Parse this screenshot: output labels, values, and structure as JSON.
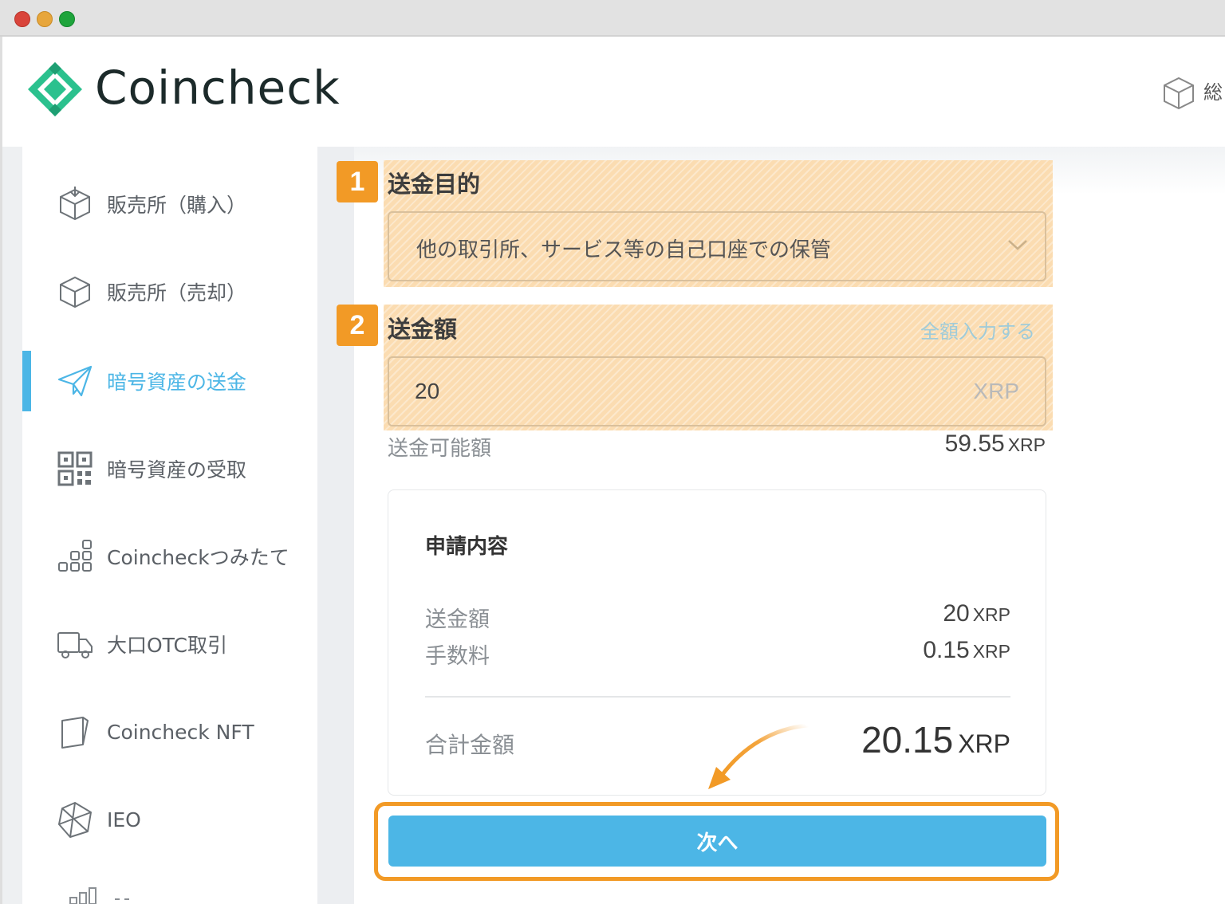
{
  "app": {
    "brand": "Coincheck",
    "header_right_label": "総"
  },
  "sidebar": {
    "items": [
      {
        "label": "販売所（購入）",
        "icon": "box-icon"
      },
      {
        "label": "販売所（売却）",
        "icon": "box-icon"
      },
      {
        "label": "暗号資産の送金",
        "icon": "paper-plane-icon",
        "active": true
      },
      {
        "label": "暗号資産の受取",
        "icon": "qr-code-icon"
      },
      {
        "label": "Coincheckつみたて",
        "icon": "stacked-squares-icon"
      },
      {
        "label": "大口OTC取引",
        "icon": "truck-icon"
      },
      {
        "label": "Coincheck NFT",
        "icon": "card-icon"
      },
      {
        "label": "IEO",
        "icon": "polyhedron-icon"
      }
    ]
  },
  "form": {
    "step1": {
      "badge": "1",
      "title": "送金目的",
      "selected": "他の取引所、サービス等の自己口座での保管"
    },
    "step2": {
      "badge": "2",
      "title": "送金額",
      "fill_all_link": "全額入力する",
      "amount": "20",
      "unit": "XRP"
    },
    "available": {
      "label": "送金可能額",
      "value": "59.55",
      "unit": "XRP"
    }
  },
  "summary": {
    "title": "申請内容",
    "rows": [
      {
        "label": "送金額",
        "value": "20",
        "unit": "XRP"
      },
      {
        "label": "手数料",
        "value": "0.15",
        "unit": "XRP"
      }
    ],
    "total": {
      "label": "合計金額",
      "value": "20.15",
      "unit": "XRP"
    }
  },
  "actions": {
    "next_label": "次へ"
  },
  "colors": {
    "accent": "#4cb6e6",
    "highlight": "#f29a26",
    "brand_green": "#2bc18e"
  }
}
